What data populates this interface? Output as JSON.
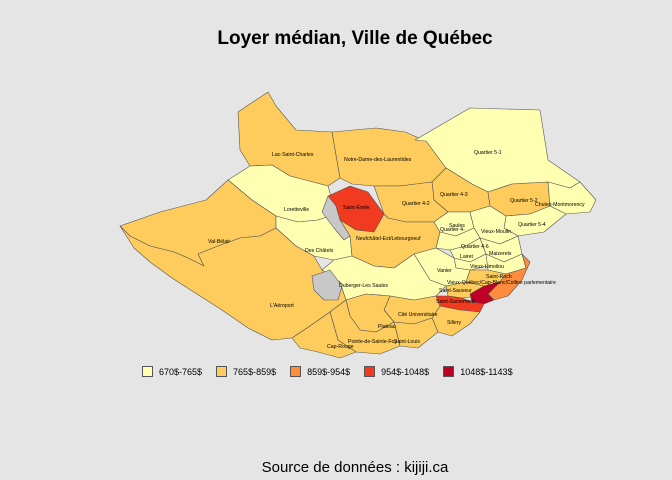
{
  "title": "Loyer médian, Ville de Québec",
  "source": "Source de données : kijiji.ca",
  "colors": {
    "c1": "#ffffb2",
    "c2": "#fecc5c",
    "c3": "#fd8d3c",
    "c4": "#f03b20",
    "c5": "#bd0026",
    "water": "#c8c8c8",
    "border": "#555555"
  },
  "legend": [
    {
      "label": "670$-765$",
      "color": "#ffffb2"
    },
    {
      "label": "765$-859$",
      "color": "#fecc5c"
    },
    {
      "label": "859$-954$",
      "color": "#fd8d3c"
    },
    {
      "label": "954$-1048$",
      "color": "#f03b20"
    },
    {
      "label": "1048$-1143$",
      "color": "#bd0026"
    }
  ],
  "districts": {
    "quartier_5_1": "Quartier 5-1",
    "lac_saint_charles": "Lac-Saint-Charles",
    "notre_dame": "Notre-Dame-des-Laurentides",
    "quartier_4_3": "Quartier 4-3",
    "quartier_5_2": "Quartier 5-2",
    "chutes": "Chutes-Montmorency",
    "saint_emile": "Saint-Émile",
    "loretteville": "Loretteville",
    "quartier_4_2": "Quartier 4-2",
    "quartier_5_4": "Quartier 5-4",
    "saules": "Saules",
    "vieux_moulin": "Vieux-Moulin",
    "val_belair": "Val-Bélair",
    "neufchatel": "Neufchâtel-Est/Lebourgneuf",
    "quartier_4_x": "Quartier 4-",
    "des_chatels": "Des Châtels",
    "quartier_4_6": "Quartier 4-6",
    "maizerets": "Maizerets",
    "lairet": "Lairet",
    "vieux_limoilou": "Vieux-Limoilou",
    "vanier": "Vanier",
    "duberger": "Duberger-Les Saules",
    "saint_roch": "Saint-Roch",
    "vieux_quebec": "Vieux-Québec/Cap-Blanc/Colline parlementaire",
    "saint_sauveur": "Saint-Sauveur",
    "saint_sacrement": "Saint-Sacrement",
    "laeroport": "L'Aéroport",
    "cite_universitaire": "Cité Universitaire",
    "sillery": "Sillery",
    "plateau": "Plateau",
    "pointe": "Pointe-de-Sainte-Foy",
    "saint_louis": "Saint-Louis",
    "cap_rouge": "Cap-Rouge"
  }
}
